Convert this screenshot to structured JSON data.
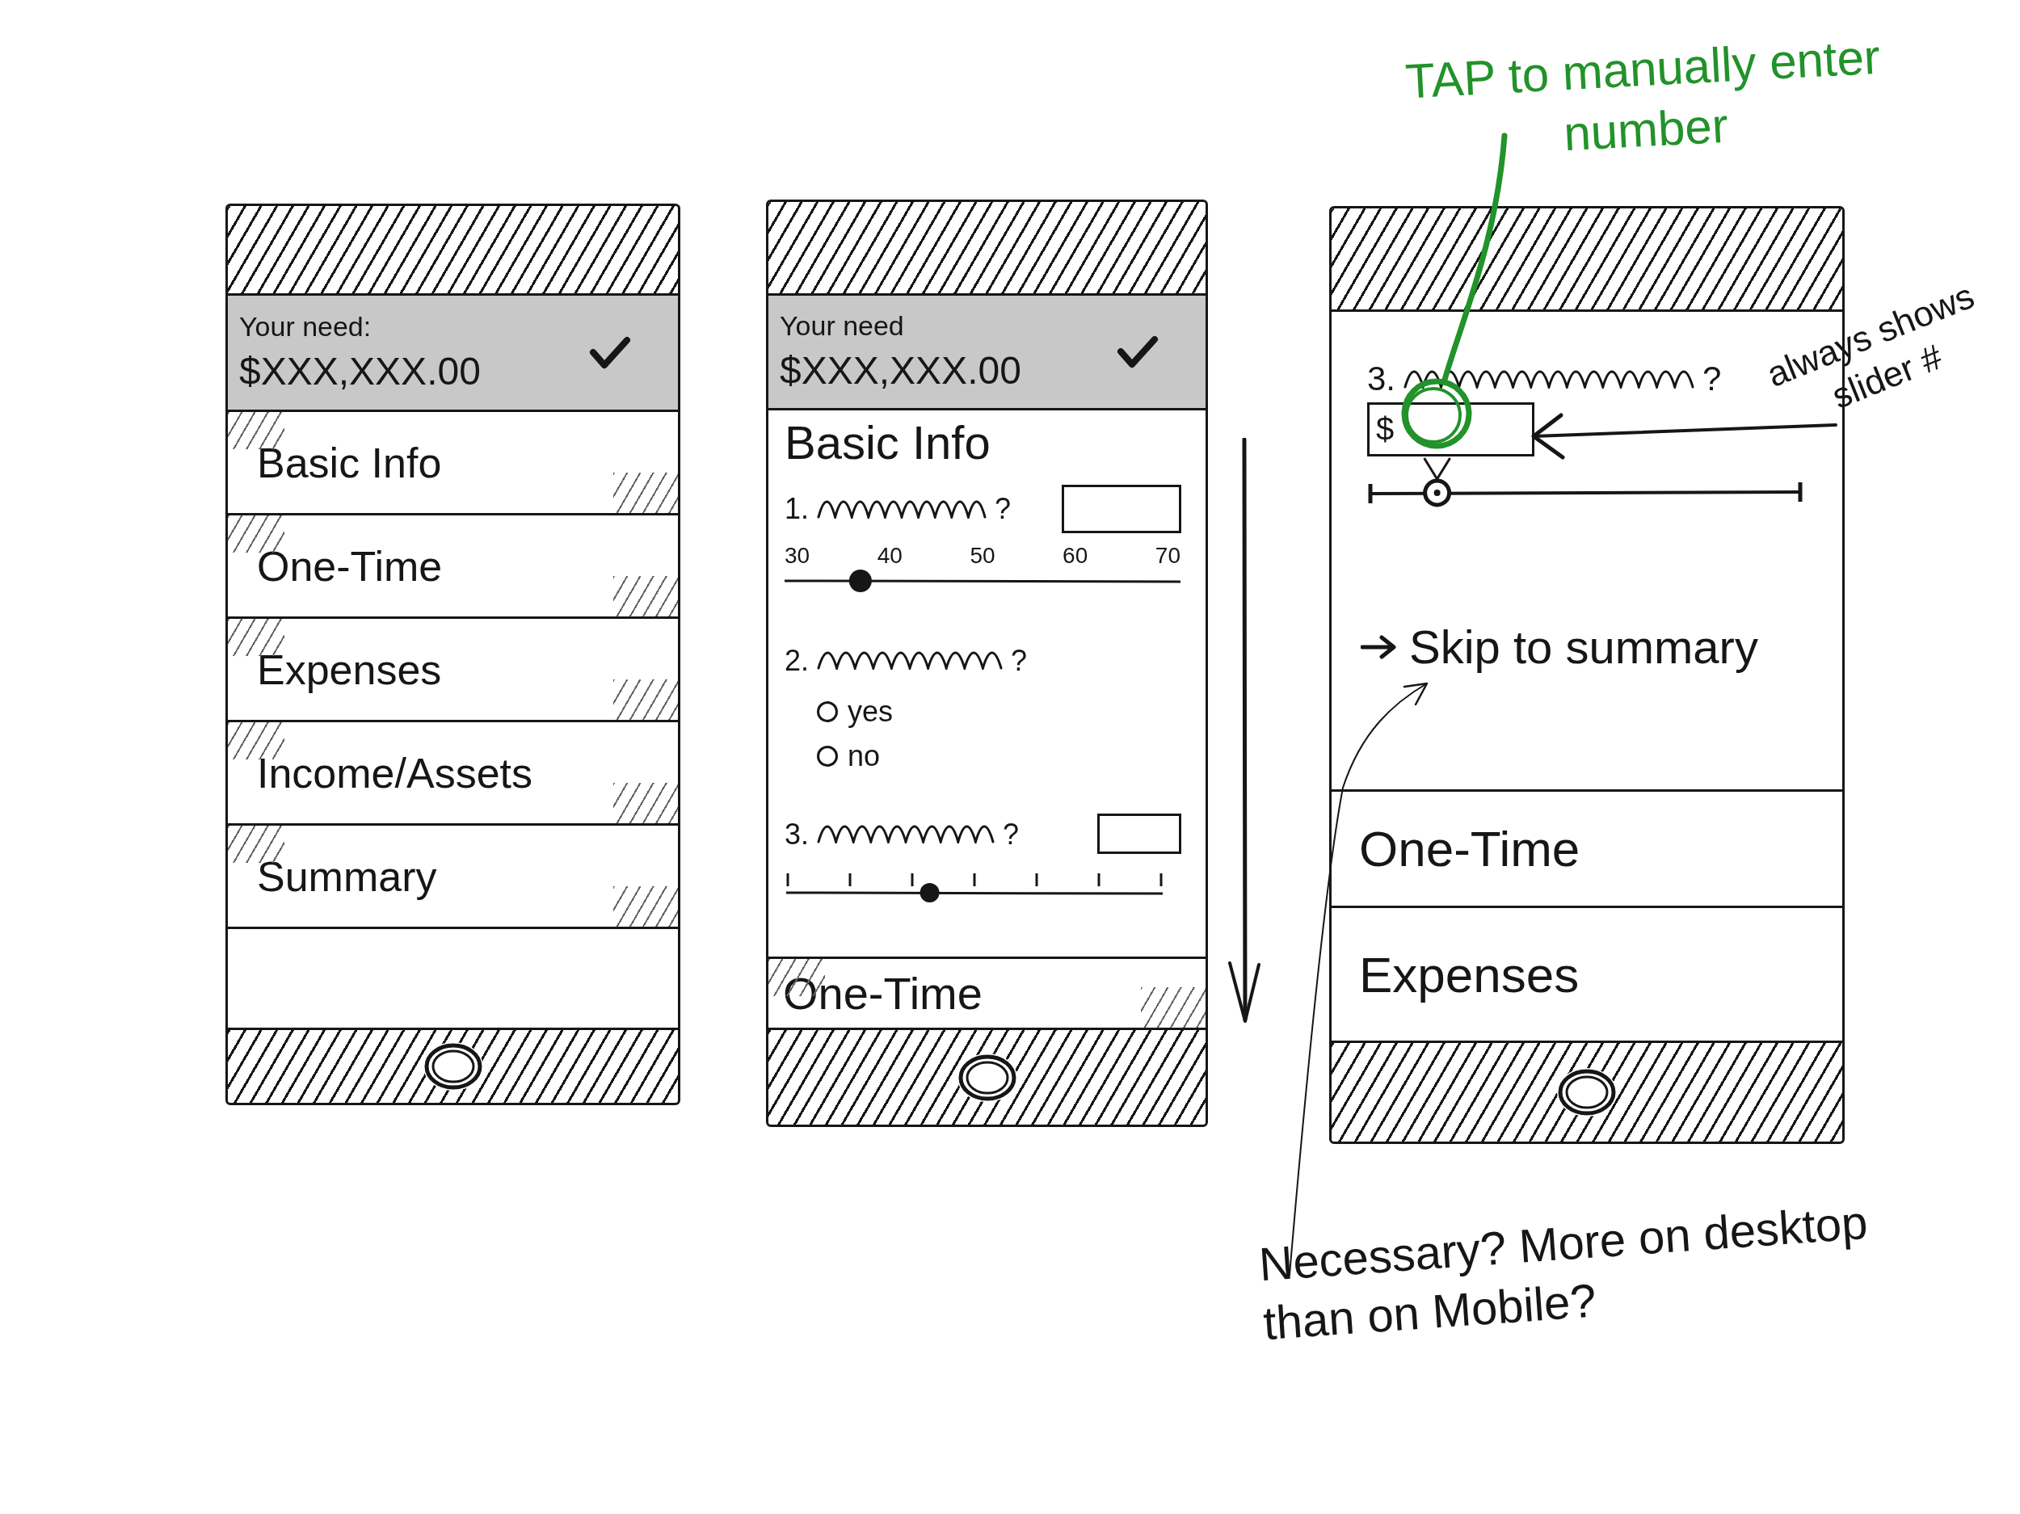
{
  "screens": [
    {
      "kind": "menu",
      "need": {
        "label": "Your need:",
        "amount": "$XXX,XXX.00"
      },
      "sections": [
        {
          "label": "Basic Info"
        },
        {
          "label": "One-Time"
        },
        {
          "label": "Expenses"
        },
        {
          "label": "Income/Assets"
        },
        {
          "label": "Summary"
        }
      ]
    },
    {
      "kind": "form",
      "need": {
        "label": "Your need",
        "amount": "$XXX,XXX.00"
      },
      "section_title": "Basic Info",
      "questions": [
        {
          "kind": "scale",
          "number": "1.",
          "suffix": "?",
          "scale": [
            "30",
            "40",
            "50",
            "60",
            "70"
          ],
          "level": 0.17
        },
        {
          "kind": "choice",
          "number": "2.",
          "suffix": "?",
          "options": [
            {
              "label": "yes",
              "selected": false
            },
            {
              "label": "no",
              "selected": false
            }
          ]
        },
        {
          "kind": "ticks",
          "number": "3.",
          "suffix": "?",
          "level": 0.38
        }
      ],
      "sections": [
        {
          "label": "One-Time"
        }
      ]
    },
    {
      "kind": "detail",
      "questions": [
        {
          "kind": "amount",
          "number": "3.",
          "suffix": "?",
          "value": "$",
          "level": 0.15
        }
      ],
      "link": "Skip to summary",
      "sections": [
        {
          "label": "One-Time"
        },
        {
          "label": "Expenses"
        }
      ]
    }
  ],
  "annotations": [
    {
      "kind": "tip",
      "text": "TAP to manually enter number"
    },
    {
      "kind": "aside",
      "text": "always shows slider #"
    },
    {
      "kind": "question",
      "text": "Necessary? More on desktop than on Mobile?"
    }
  ]
}
